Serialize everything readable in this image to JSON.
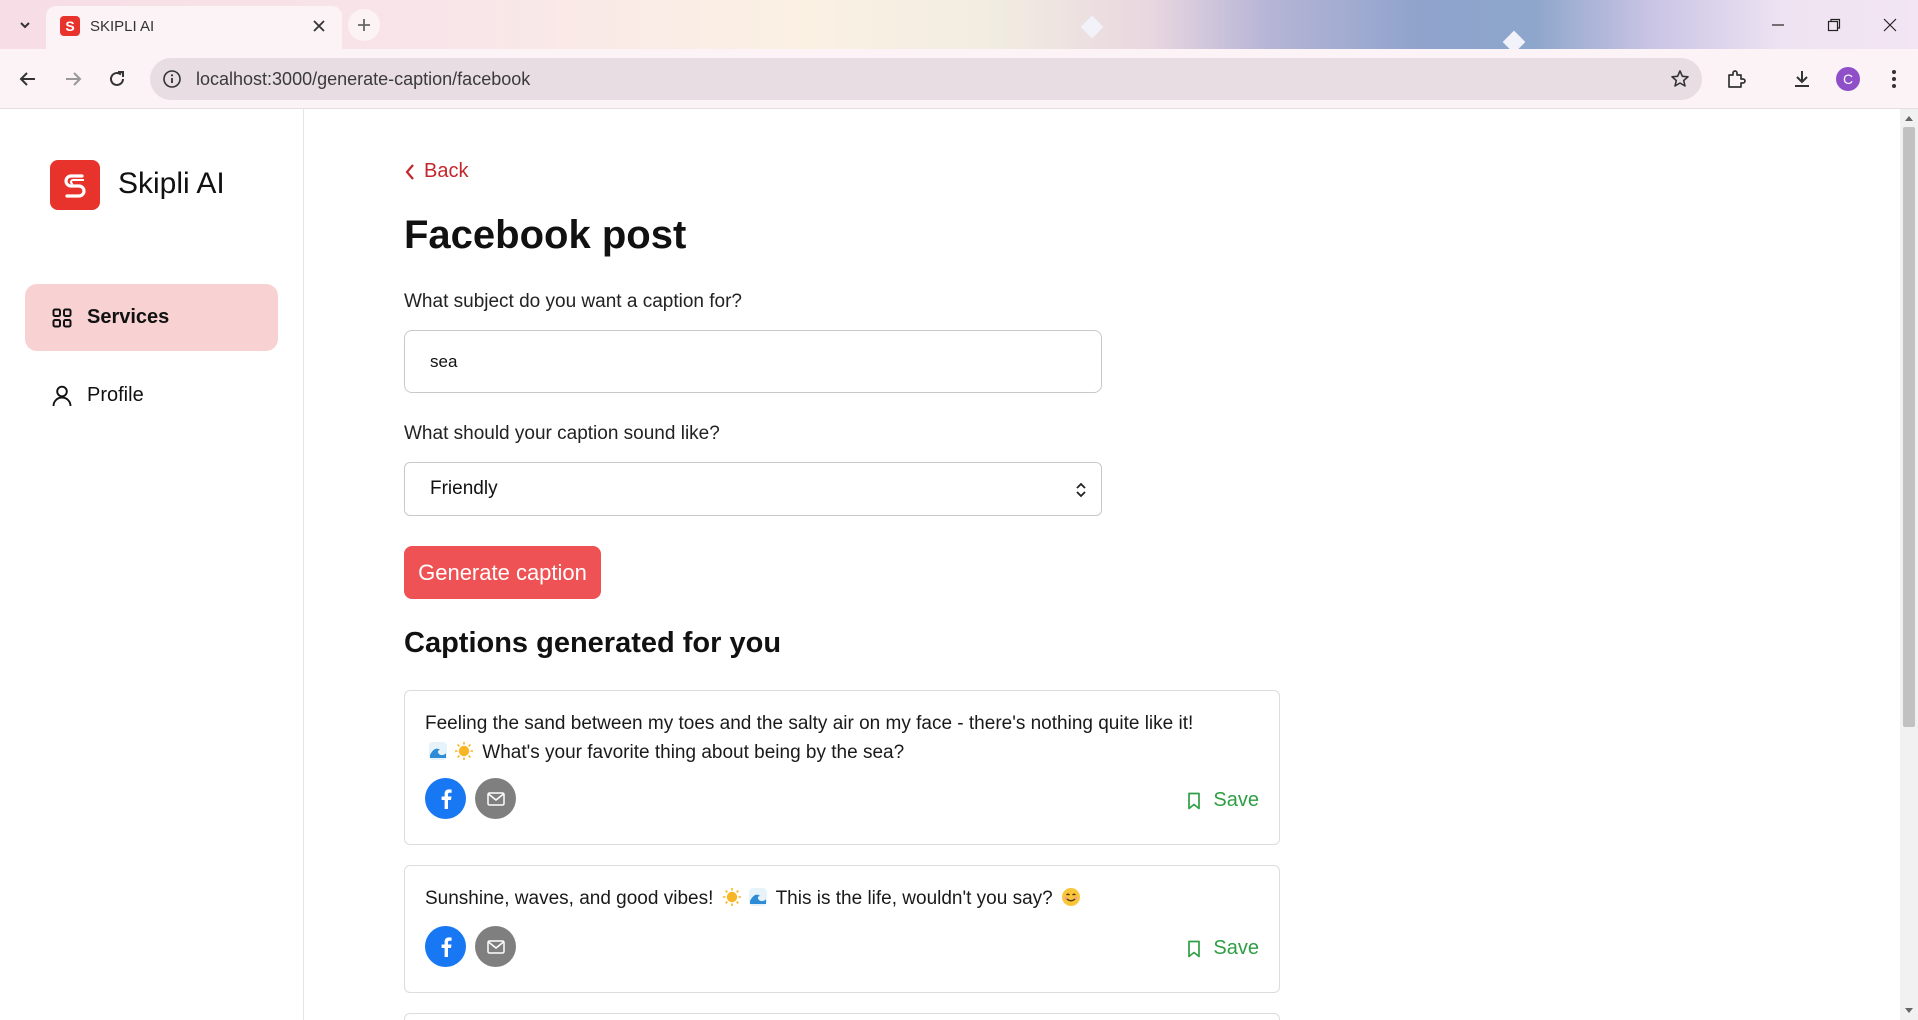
{
  "browser": {
    "tab_title": "SKIPLI AI",
    "url": "localhost:3000/generate-caption/facebook",
    "profile_initial": "C",
    "tab_favicon_letter": "S"
  },
  "sidebar": {
    "brand": "Skipli AI",
    "items": [
      {
        "label": "Services",
        "icon": "grid-icon",
        "active": true
      },
      {
        "label": "Profile",
        "icon": "user-icon",
        "active": false
      }
    ]
  },
  "main": {
    "back_label": "Back",
    "title": "Facebook post",
    "subject_label": "What subject do you want a caption for?",
    "subject_value": "sea",
    "tone_label": "What should your caption sound like?",
    "tone_value": "Friendly",
    "generate_label": "Generate caption",
    "results_title": "Captions generated for you"
  },
  "captions": [
    {
      "line1": "Feeling the sand between my toes and the salty air on my face - there's nothing quite like it!",
      "line2": "What's your favorite thing about being by the sea?",
      "save_label": "Save"
    },
    {
      "part1": "Sunshine, waves, and good vibes!",
      "part2": "This is the life, wouldn't you say?",
      "save_label": "Save"
    }
  ],
  "colors": {
    "brand_red": "#e8322c",
    "button_red": "#ef5254",
    "active_nav_bg": "#f8d1d2",
    "save_green": "#2f9e45",
    "facebook_blue": "#1877f2"
  }
}
